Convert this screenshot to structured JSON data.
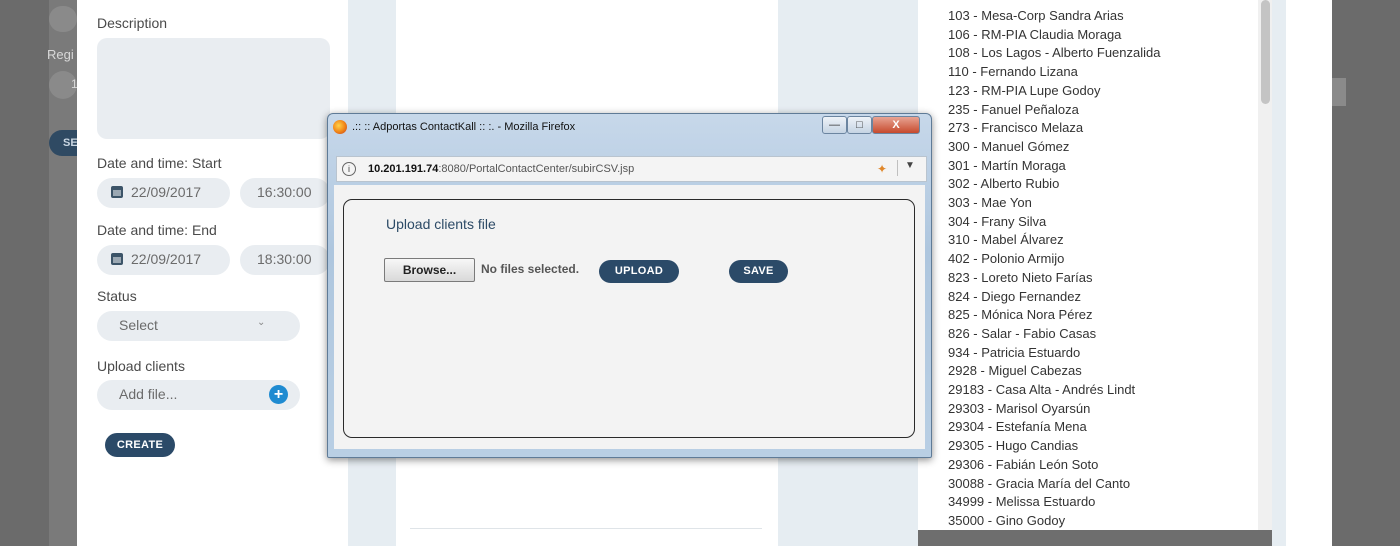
{
  "form": {
    "description_label": "Description",
    "peek_region_label": "Regi",
    "peek_value": "1",
    "peek_button": "SE",
    "start_label": "Date and time: Start",
    "start_date": "22/09/2017",
    "start_time": "16:30:00",
    "end_label": "Date and time: End",
    "end_date": "22/09/2017",
    "end_time": "18:30:00",
    "status_label": "Status",
    "status_value": "Select",
    "upload_label": "Upload clients",
    "upload_placeholder": "Add file...",
    "create_button": "CREATE"
  },
  "list": {
    "items": [
      "103 - Mesa-Corp Sandra Arias",
      "106 - RM-PIA Claudia Moraga",
      "108 - Los Lagos - Alberto Fuenzalida",
      "110 - Fernando Lizana",
      "123 - RM-PIA Lupe Godoy",
      "235 - Fanuel Peñaloza",
      "273 - Francisco Melaza",
      "300 - Manuel Gómez",
      "301 - Martín Moraga",
      "302 - Alberto Rubio",
      "303 - Mae Yon",
      "304 - Frany Silva",
      "310 - Mabel Álvarez",
      "402 - Polonio Armijo",
      "823 - Loreto Nieto Farías",
      "824 - Diego Fernandez",
      "825 - Mónica Nora Pérez",
      "826 - Salar - Fabio Casas",
      "934 - Patricia Estuardo",
      "2928 - Miguel Cabezas",
      "29183 - Casa Alta - Andrés Lindt",
      "29303 - Marisol Oyarsún",
      "29304 - Estefanía Mena",
      "29305 - Hugo Candias",
      "29306 - Fabián León Soto",
      "30088 - Gracia María del Canto",
      "34999 - Melissa Estuardo",
      "35000 - Gino Godoy"
    ]
  },
  "popup": {
    "title": ".:: :: Adportas ContactKall :: :. - Mozilla Firefox",
    "url_host": "10.201.191.74",
    "url_rest": ":8080/PortalContactCenter/subirCSV.jsp",
    "info_icon": "i",
    "heading": "Upload clients file",
    "browse_button": "Browse...",
    "no_file_text": "No files selected.",
    "upload_button": "UPLOAD",
    "save_button": "SAVE",
    "min_glyph": "—",
    "max_glyph": "□",
    "close_glyph": "X"
  },
  "colors": {
    "accent": "#2b4a68",
    "plus": "#1f8bd1",
    "background_panel": "#e6edf2"
  }
}
